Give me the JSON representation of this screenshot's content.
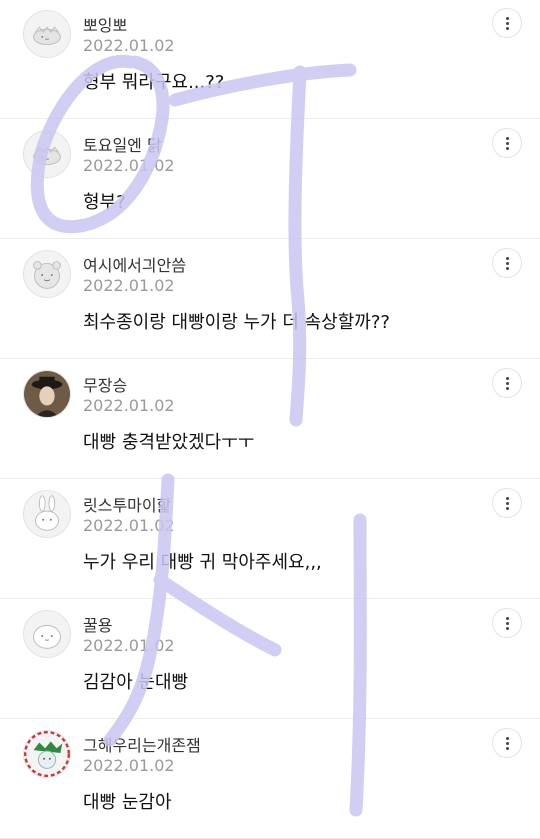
{
  "comments": [
    {
      "nickname": "뽀잉뽀",
      "date": "2022.01.02",
      "text": "형부 뭐라구요...??",
      "avatar_icon": "dino-avatar-icon"
    },
    {
      "nickname": "토요일엔 닭",
      "date": "2022.01.02",
      "text": "형부?",
      "avatar_icon": "dino-avatar-icon"
    },
    {
      "nickname": "여시에서긔안씀",
      "date": "2022.01.02",
      "text": "최수종이랑 대빵이랑 누가 더 속상할까??",
      "avatar_icon": "bear-avatar-icon"
    },
    {
      "nickname": "무장승",
      "date": "2022.01.02",
      "text": "대빵 충격받았겠다ㅜㅜ",
      "avatar_icon": "photo-avatar-icon"
    },
    {
      "nickname": "릿스투마이핥",
      "date": "2022.01.02",
      "text": "누가 우리 대빵 귀 막아주세요,,,",
      "avatar_icon": "bunny-avatar-icon"
    },
    {
      "nickname": "꿀용",
      "date": "2022.01.02",
      "text": "김감아 눈대빵",
      "avatar_icon": "blob-avatar-icon"
    },
    {
      "nickname": "그해우리는개존잼",
      "date": "2022.01.02",
      "text": "대빵 눈감아",
      "avatar_icon": "christmas-avatar-icon"
    }
  ],
  "more_icon": "more-vertical-icon",
  "colors": {
    "scribble": "#c9c6f2",
    "date": "#9a9a9a",
    "divider": "#ececec"
  }
}
